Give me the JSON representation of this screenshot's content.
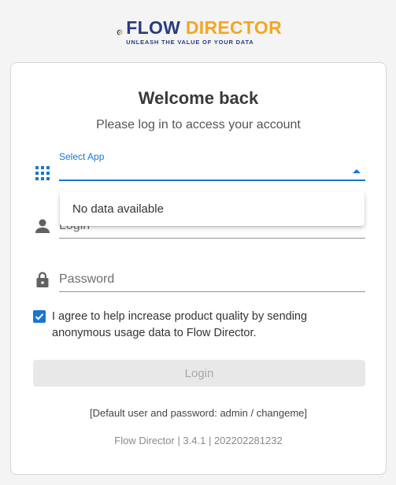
{
  "brand": {
    "name_part1": "FLOW",
    "name_part2": " DIRECTOR",
    "tagline": "UNLEASH THE VALUE OF YOUR DATA",
    "primary_color": "#2b3b7f",
    "accent_color": "#f5a623"
  },
  "login": {
    "title": "Welcome back",
    "subtitle": "Please log in to access your account",
    "select_app": {
      "label": "Select App",
      "icon": "apps-grid-icon",
      "dropdown_message": "No data available"
    },
    "login_field": {
      "placeholder": "Login",
      "icon": "person-icon"
    },
    "password_field": {
      "placeholder": "Password",
      "icon": "lock-icon"
    },
    "consent": {
      "checked": true,
      "text": "I agree to help increase product quality by sending anonymous usage data to Flow Director."
    },
    "submit_label": "Login",
    "default_credentials": "[Default user and password: admin / changeme]",
    "version_info": "Flow Director | 3.4.1 | 202202281232"
  },
  "colors": {
    "focus": "#1976d2",
    "icon": "#616161",
    "button_disabled_bg": "#e8e8e8"
  }
}
